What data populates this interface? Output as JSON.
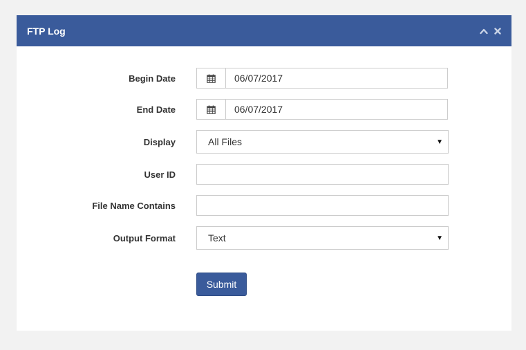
{
  "panel": {
    "title": "FTP Log",
    "icons": [
      "chevron-up-icon",
      "close-icon"
    ]
  },
  "form": {
    "begin_date": {
      "label": "Begin Date",
      "value": "06/07/2017",
      "icon": "calendar-icon"
    },
    "end_date": {
      "label": "End Date",
      "value": "06/07/2017",
      "icon": "calendar-icon"
    },
    "display": {
      "label": "Display",
      "value": "All Files"
    },
    "user_id": {
      "label": "User ID",
      "value": "",
      "placeholder": ""
    },
    "file_name": {
      "label": "File Name Contains",
      "value": "",
      "placeholder": ""
    },
    "output_format": {
      "label": "Output Format",
      "value": "Text"
    },
    "submit_label": "Submit"
  },
  "colors": {
    "header_bg": "#3a5b9b",
    "button_bg": "#3a5b9b",
    "page_bg": "#f2f2f2"
  }
}
